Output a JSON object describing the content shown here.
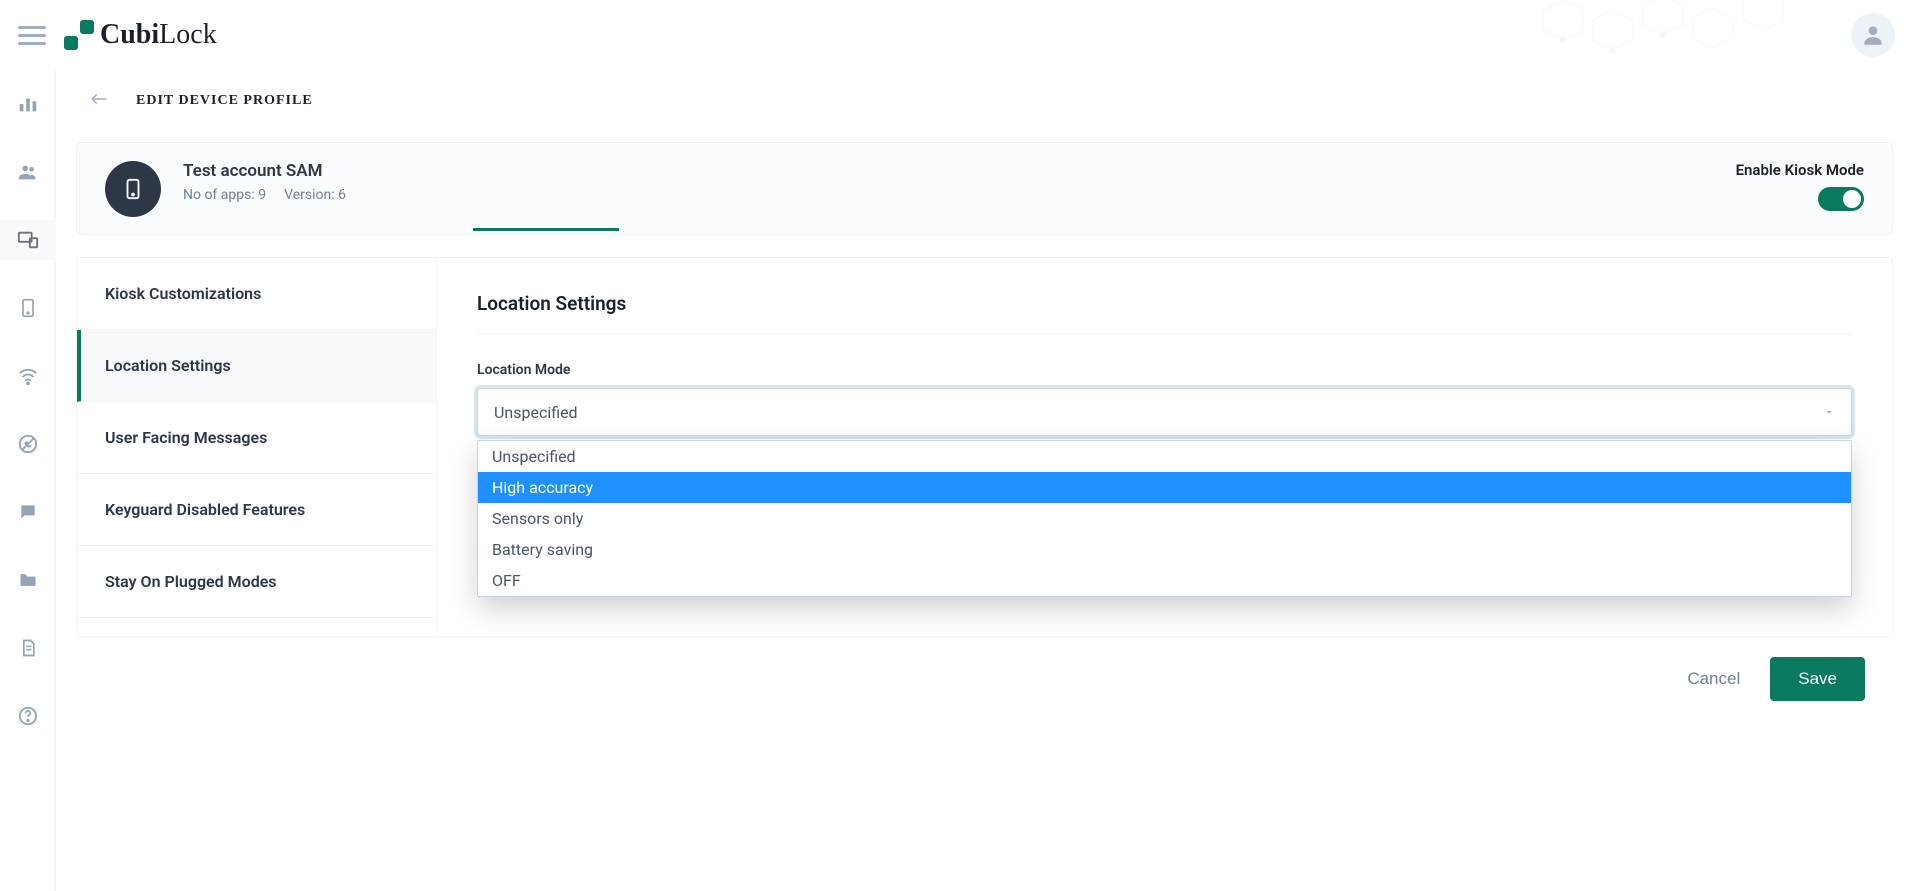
{
  "brand": {
    "name_part1": "Cubi",
    "name_part2": "Lock"
  },
  "page": {
    "title": "EDIT DEVICE PROFILE"
  },
  "profile": {
    "name": "Test account SAM",
    "apps_label": "No of apps: 9",
    "version_label": "Version: 6",
    "kiosk_label": "Enable Kiosk Mode"
  },
  "settings_nav": [
    {
      "label": "Kiosk Customizations",
      "active": false
    },
    {
      "label": "Location Settings",
      "active": true
    },
    {
      "label": "User Facing Messages",
      "active": false
    },
    {
      "label": "Keyguard Disabled Features",
      "active": false
    },
    {
      "label": "Stay On Plugged Modes",
      "active": false
    }
  ],
  "panel": {
    "title": "Location Settings",
    "field_label": "Location Mode",
    "selected_value": "Unspecified",
    "options": [
      {
        "label": "Unspecified",
        "highlighted": false
      },
      {
        "label": "High accuracy",
        "highlighted": true
      },
      {
        "label": "Sensors only",
        "highlighted": false
      },
      {
        "label": "Battery saving",
        "highlighted": false
      },
      {
        "label": "OFF",
        "highlighted": false
      }
    ]
  },
  "actions": {
    "cancel": "Cancel",
    "save": "Save"
  }
}
